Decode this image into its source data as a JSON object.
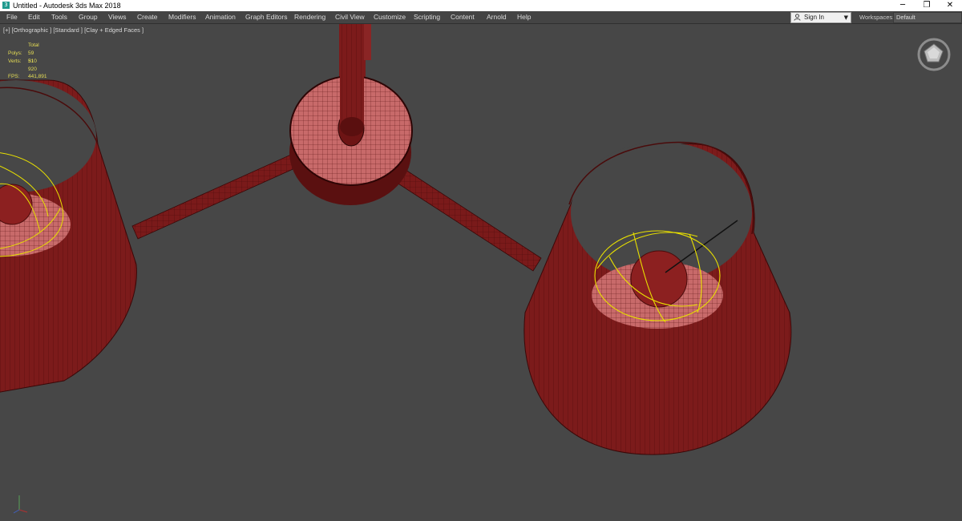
{
  "window": {
    "title": "Untitled - Autodesk 3ds Max 2018",
    "app_icon_glyph": "3",
    "minimize_glyph": "─",
    "restore_glyph": "❐",
    "close_glyph": "✕"
  },
  "menu": {
    "items": [
      "File",
      "Edit",
      "Tools",
      "Group",
      "Views",
      "Create",
      "Modifiers",
      "Animation",
      "Graph Editors",
      "Rendering",
      "Civil View",
      "Customize",
      "Scripting",
      "Content",
      "Arnold",
      "Help"
    ]
  },
  "account": {
    "sign_in_label": "Sign In",
    "caret_glyph": "▼",
    "workspaces_label": "Workspaces:",
    "workspaces_value": "Default"
  },
  "viewport": {
    "label": "[+] [Orthographic ] [Standard ] [Clay + Edged Faces ]",
    "stats": {
      "header": "Total",
      "polys_label": "Polys:",
      "polys_value": "59 510",
      "verts_label": "Verts:",
      "verts_value": "31 920",
      "fps_label": "FPS:",
      "fps_value": "441,891"
    }
  },
  "colors": {
    "viewport_bg": "#474747",
    "mesh_fill": "#7a1a1a",
    "mesh_edge": "#3a0808",
    "light_gizmo": "#e8e000",
    "stats_text": "#e6dd55"
  },
  "icons": {
    "user": "user-icon",
    "viewcube": "viewcube-icon",
    "axis": "axis-tripod-icon"
  }
}
